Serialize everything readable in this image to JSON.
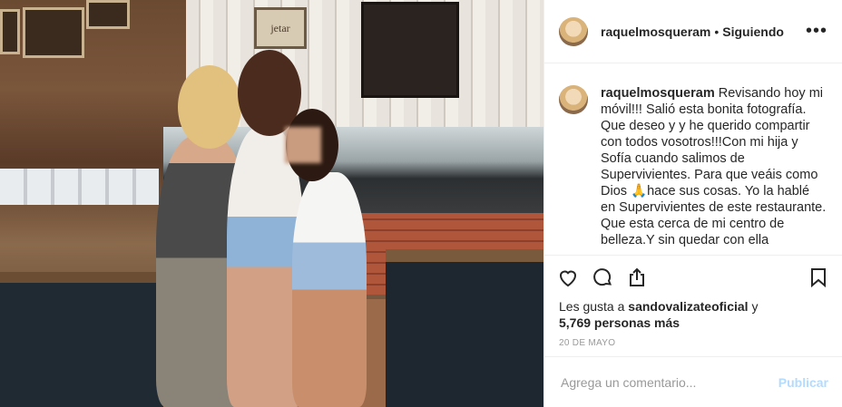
{
  "header": {
    "username": "raquelmosqueram",
    "separator": "•",
    "follow_status": "Siguiendo",
    "more_label": "•••"
  },
  "caption": {
    "username": "raquelmosqueram",
    "text": "Revisando hoy mi móvil!!! Salió esta bonita fotografía. Que deseo y y he querido compartir con todos vosotros!!!Con mi hija y Sofía cuando salimos de Supervivientes. Para que veáis como Dios 🙏hace sus cosas. Yo la hablé en Supervivientes de este restaurante. Que esta cerca de mi centro de belleza.Y sin quedar con ella"
  },
  "actions": {
    "icons": [
      "heart-icon",
      "comment-icon",
      "share-icon",
      "bookmark-icon"
    ]
  },
  "likes": {
    "prefix": "Les gusta a",
    "user": "sandovalizateoficial",
    "conjunction": "y",
    "count": "5,769 personas más"
  },
  "date": "20 DE MAYO",
  "comment_box": {
    "placeholder": "Agrega un comentario...",
    "submit_label": "Publicar"
  },
  "photo": {
    "sign_text": "jetar"
  }
}
